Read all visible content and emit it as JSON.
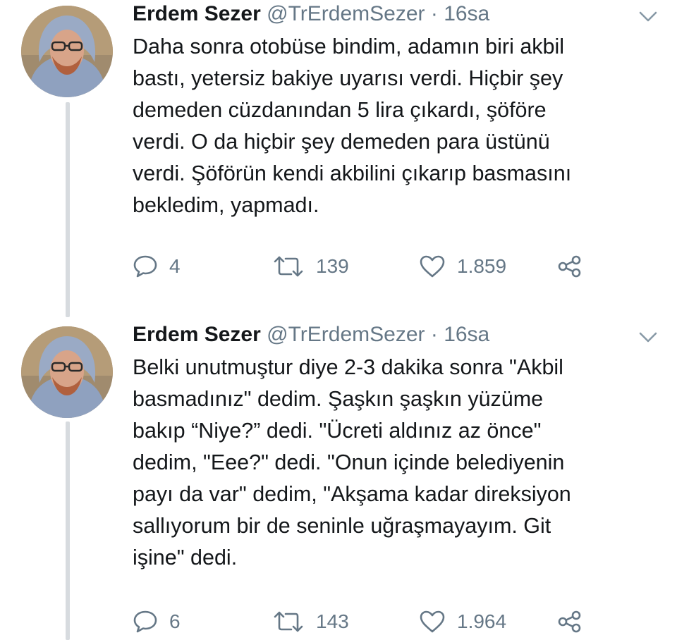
{
  "tweets": [
    {
      "author": {
        "name": "Erdem Sezer",
        "handle": "@TrErdemSezer"
      },
      "separator": "·",
      "time": "16sa",
      "text": "Daha sonra otobüse bindim, adamın biri akbil\nbastı, yetersiz bakiye uyarısı verdi. Hiçbir şey\ndemeden cüzdanından 5 lira çıkardı, şöföre\nverdi. O da hiçbir şey demeden para üstünü\nverdi. Şöförün kendi akbilini çıkarıp basmasını\nbekledim, yapmadı.",
      "replies": "4",
      "retweets": "139",
      "likes": "1.859",
      "icons": {
        "menu": "chevron-down-icon",
        "reply": "reply-icon",
        "retweet": "retweet-icon",
        "like": "heart-icon",
        "share": "share-icon"
      }
    },
    {
      "author": {
        "name": "Erdem Sezer",
        "handle": "@TrErdemSezer"
      },
      "separator": "·",
      "time": "16sa",
      "text": "Belki unutmuştur diye 2-3 dakika sonra \"Akbil\nbasmadınız\" dedim. Şaşkın şaşkın yüzüme\nbakıp “Niye?” dedi. \"Ücreti aldınız az önce\"\ndedim, \"Eee?\" dedi. \"Onun içinde belediyenin\npayı da var\" dedim, \"Akşama kadar direksiyon\nsallıyorum bir de seninle uğraşmayayım. Git\nişine\" dedi.",
      "replies": "6",
      "retweets": "143",
      "likes": "1.964",
      "icons": {
        "menu": "chevron-down-icon",
        "reply": "reply-icon",
        "retweet": "retweet-icon",
        "like": "heart-icon",
        "share": "share-icon"
      }
    }
  ],
  "colors": {
    "text": "#14171a",
    "muted": "#657786",
    "thread_line": "#d7dbdf"
  }
}
